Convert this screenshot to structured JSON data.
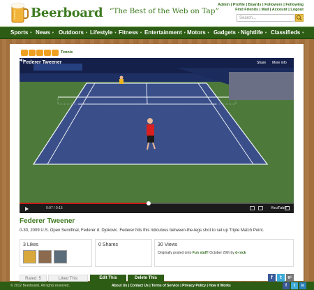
{
  "header": {
    "logo_text": "Beerboard",
    "tagline": "“The Best of the Web on Tap”",
    "toplinks_row1": "Admin | Profile | Boards | Followers | Following",
    "toplinks_row2": "Find Friends | Mail | Account | Logout",
    "search_placeholder": "Search..."
  },
  "nav": {
    "items": [
      "Sports",
      "News",
      "Outdoors",
      "Lifestyle",
      "Fitness",
      "Entertainment",
      "Motors",
      "Gadgets",
      "Nightlife",
      "Classifieds"
    ]
  },
  "post": {
    "rating": 5,
    "category": "Tennis",
    "video": {
      "title": "Federer Tweener",
      "share_label": "Share",
      "more_info_label": "More info",
      "time": "0:07 / 0:15",
      "progress": 0.47,
      "provider": "YouTube"
    },
    "title": "Federer Tweener",
    "description": "0-30, 2009 U.S. Open Semifinal, Federer d. Djokovic. Federer hits this ridiculous between-the-legs shot to set up Triple Match Point.",
    "likes_label": "3 Likes",
    "shares_label": "0 Shares",
    "views_label": "30 Views",
    "posted_prefix": "Originally posted onto ",
    "posted_board": "Fun stuff!",
    "posted_middle": " October 29th by ",
    "posted_user": "d-rock"
  },
  "actions": {
    "rated": "Rated: 5",
    "liked": "Liked This",
    "edit": "Edit This",
    "delete": "Delete This"
  },
  "social": {
    "facebook": "f",
    "twitter": "t",
    "google": "g+"
  },
  "footer": {
    "copyright": "© 2012 Beerboard. All rights reserved.",
    "links": [
      "About Us",
      "Contact Us",
      "Terms of Service",
      "Privacy Policy",
      "How it Works"
    ]
  },
  "colors": {
    "brand_green": "#3d7a1f",
    "nav_green": "#2d5c15",
    "accent_gold": "#e9c24a",
    "facebook_blue": "#3b5998",
    "twitter_blue": "#3fa9d8",
    "google_red": "#777777"
  }
}
